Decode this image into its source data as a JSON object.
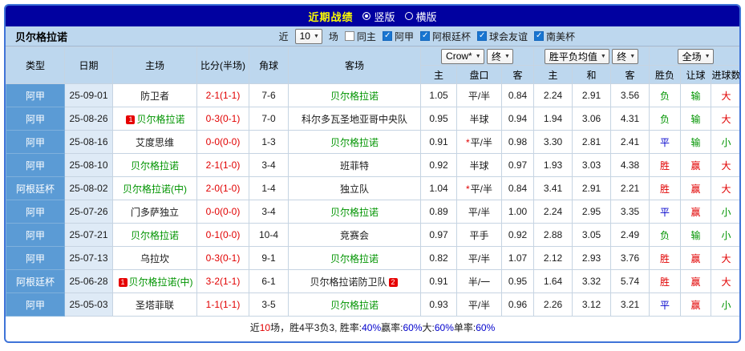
{
  "colors": {
    "frame_border": "#3F74D8",
    "title_bar": "#0101A0",
    "title_text": "#FFFF00",
    "header_blue": "#BDD7EE",
    "type_column_blue": "#5B9BD5",
    "date_column_blue": "#DEEAF6",
    "score_red": "#E10000",
    "team_green": "#009400",
    "draw_blue": "#0000CC",
    "badge_red": "#E60000"
  },
  "title_bar": {
    "title": "近期战绩",
    "radio_vertical": "竖版",
    "radio_horizontal": "横版"
  },
  "filter_bar": {
    "team_name": "贝尔格拉诺",
    "near_label": "近",
    "count_value": "10",
    "unit_label": "场",
    "checkboxes": [
      {
        "label": "同主",
        "checked": false
      },
      {
        "label": "阿甲",
        "checked": true
      },
      {
        "label": "阿根廷杯",
        "checked": true
      },
      {
        "label": "球会友谊",
        "checked": true
      },
      {
        "label": "南美杯",
        "checked": true
      }
    ]
  },
  "table": {
    "headers": {
      "type": "类型",
      "date": "日期",
      "home": "主场",
      "score": "比分(半场)",
      "corner": "角球",
      "away": "客场",
      "odds_company": "Crow*",
      "asia_final": "终",
      "europe_odds": "胜平负均值",
      "europe_final": "终",
      "full_match": "全场",
      "sub": {
        "asia_home": "主",
        "handicap": "盘口",
        "asia_away": "客",
        "euro_win": "主",
        "euro_draw": "和",
        "euro_lose": "客",
        "wdl": "胜负",
        "let_ball": "让球",
        "goals": "进球数"
      }
    },
    "rows": [
      {
        "type": "阿甲",
        "date": "25-09-01",
        "home": {
          "text": "防卫者",
          "color": "black",
          "badge": null
        },
        "score": "2-1(1-1)",
        "corner": "7-6",
        "away": {
          "text": "贝尔格拉诺",
          "color": "green",
          "badge": null
        },
        "odds": {
          "home": "1.05",
          "handicap": "平/半",
          "star": false,
          "away": "0.84"
        },
        "europe": {
          "win": "2.24",
          "draw": "2.91",
          "lose": "3.56"
        },
        "result": {
          "wdl": "负",
          "wdl_color": "green",
          "handicap": "输",
          "handicap_color": "green",
          "goals": "大",
          "goals_color": "red"
        }
      },
      {
        "type": "阿甲",
        "date": "25-08-26",
        "home": {
          "text": "贝尔格拉诺",
          "color": "green",
          "badge": "1"
        },
        "score": "0-3(0-1)",
        "corner": "7-0",
        "away": {
          "text": "科尔多瓦圣地亚哥中央队",
          "color": "black",
          "badge": null
        },
        "odds": {
          "home": "0.95",
          "handicap": "半球",
          "star": false,
          "away": "0.94"
        },
        "europe": {
          "win": "1.94",
          "draw": "3.06",
          "lose": "4.31"
        },
        "result": {
          "wdl": "负",
          "wdl_color": "green",
          "handicap": "输",
          "handicap_color": "green",
          "goals": "大",
          "goals_color": "red"
        }
      },
      {
        "type": "阿甲",
        "date": "25-08-16",
        "home": {
          "text": "艾度思维",
          "color": "black",
          "badge": null
        },
        "score": "0-0(0-0)",
        "corner": "1-3",
        "away": {
          "text": "贝尔格拉诺",
          "color": "green",
          "badge": null
        },
        "odds": {
          "home": "0.91",
          "handicap": "平/半",
          "star": true,
          "away": "0.98"
        },
        "europe": {
          "win": "3.30",
          "draw": "2.81",
          "lose": "2.41"
        },
        "result": {
          "wdl": "平",
          "wdl_color": "blue",
          "handicap": "输",
          "handicap_color": "green",
          "goals": "小",
          "goals_color": "green"
        }
      },
      {
        "type": "阿甲",
        "date": "25-08-10",
        "home": {
          "text": "贝尔格拉诺",
          "color": "green",
          "badge": null
        },
        "score": "2-1(1-0)",
        "corner": "3-4",
        "away": {
          "text": "班菲特",
          "color": "black",
          "badge": null
        },
        "odds": {
          "home": "0.92",
          "handicap": "半球",
          "star": false,
          "away": "0.97"
        },
        "europe": {
          "win": "1.93",
          "draw": "3.03",
          "lose": "4.38"
        },
        "result": {
          "wdl": "胜",
          "wdl_color": "red",
          "handicap": "赢",
          "handicap_color": "red",
          "goals": "大",
          "goals_color": "red"
        }
      },
      {
        "type": "阿根廷杯",
        "date": "25-08-02",
        "home": {
          "text": "贝尔格拉诺(中)",
          "color": "green",
          "badge": null
        },
        "score": "2-0(1-0)",
        "corner": "1-4",
        "away": {
          "text": "独立队",
          "color": "black",
          "badge": null
        },
        "odds": {
          "home": "1.04",
          "handicap": "平/半",
          "star": true,
          "away": "0.84"
        },
        "europe": {
          "win": "3.41",
          "draw": "2.91",
          "lose": "2.21"
        },
        "result": {
          "wdl": "胜",
          "wdl_color": "red",
          "handicap": "赢",
          "handicap_color": "red",
          "goals": "大",
          "goals_color": "red"
        }
      },
      {
        "type": "阿甲",
        "date": "25-07-26",
        "home": {
          "text": "门多萨独立",
          "color": "black",
          "badge": null
        },
        "score": "0-0(0-0)",
        "corner": "3-4",
        "away": {
          "text": "贝尔格拉诺",
          "color": "green",
          "badge": null
        },
        "odds": {
          "home": "0.89",
          "handicap": "平/半",
          "star": false,
          "away": "1.00"
        },
        "europe": {
          "win": "2.24",
          "draw": "2.95",
          "lose": "3.35"
        },
        "result": {
          "wdl": "平",
          "wdl_color": "blue",
          "handicap": "赢",
          "handicap_color": "red",
          "goals": "小",
          "goals_color": "green"
        }
      },
      {
        "type": "阿甲",
        "date": "25-07-21",
        "home": {
          "text": "贝尔格拉诺",
          "color": "green",
          "badge": null
        },
        "score": "0-1(0-0)",
        "corner": "10-4",
        "away": {
          "text": "竞赛会",
          "color": "black",
          "badge": null
        },
        "odds": {
          "home": "0.97",
          "handicap": "平手",
          "star": false,
          "away": "0.92"
        },
        "europe": {
          "win": "2.88",
          "draw": "3.05",
          "lose": "2.49"
        },
        "result": {
          "wdl": "负",
          "wdl_color": "green",
          "handicap": "输",
          "handicap_color": "green",
          "goals": "小",
          "goals_color": "green"
        }
      },
      {
        "type": "阿甲",
        "date": "25-07-13",
        "home": {
          "text": "乌拉坎",
          "color": "black",
          "badge": null
        },
        "score": "0-3(0-1)",
        "corner": "9-1",
        "away": {
          "text": "贝尔格拉诺",
          "color": "green",
          "badge": null
        },
        "odds": {
          "home": "0.82",
          "handicap": "平/半",
          "star": false,
          "away": "1.07"
        },
        "europe": {
          "win": "2.12",
          "draw": "2.93",
          "lose": "3.76"
        },
        "result": {
          "wdl": "胜",
          "wdl_color": "red",
          "handicap": "赢",
          "handicap_color": "red",
          "goals": "大",
          "goals_color": "red"
        }
      },
      {
        "type": "阿根廷杯",
        "date": "25-06-28",
        "home": {
          "text": "贝尔格拉诺(中)",
          "color": "green",
          "badge": "1"
        },
        "score": "3-2(1-1)",
        "corner": "6-1",
        "away": {
          "text": "贝尔格拉诺防卫队",
          "color": "black",
          "badge": "2"
        },
        "odds": {
          "home": "0.91",
          "handicap": "半/一",
          "star": false,
          "away": "0.95"
        },
        "europe": {
          "win": "1.64",
          "draw": "3.32",
          "lose": "5.74"
        },
        "result": {
          "wdl": "胜",
          "wdl_color": "red",
          "handicap": "赢",
          "handicap_color": "red",
          "goals": "大",
          "goals_color": "red"
        }
      },
      {
        "type": "阿甲",
        "date": "25-05-03",
        "home": {
          "text": "圣塔菲联",
          "color": "black",
          "badge": null
        },
        "score": "1-1(1-1)",
        "corner": "3-5",
        "away": {
          "text": "贝尔格拉诺",
          "color": "green",
          "badge": null
        },
        "odds": {
          "home": "0.93",
          "handicap": "平/半",
          "star": false,
          "away": "0.96"
        },
        "europe": {
          "win": "2.26",
          "draw": "3.12",
          "lose": "3.21"
        },
        "result": {
          "wdl": "平",
          "wdl_color": "blue",
          "handicap": "赢",
          "handicap_color": "red",
          "goals": "小",
          "goals_color": "green"
        }
      }
    ]
  },
  "footer": {
    "segments": [
      {
        "text": "近",
        "color": "black"
      },
      {
        "text": "10",
        "color": "red"
      },
      {
        "text": "场，胜4平3负3, 胜率:",
        "color": "black"
      },
      {
        "text": "40%",
        "color": "blue"
      },
      {
        "text": " 赢率:",
        "color": "black"
      },
      {
        "text": "60%",
        "color": "blue"
      },
      {
        "text": " 大:",
        "color": "black"
      },
      {
        "text": "60%",
        "color": "blue"
      },
      {
        "text": " 单率:",
        "color": "black"
      },
      {
        "text": "60%",
        "color": "blue"
      }
    ]
  }
}
